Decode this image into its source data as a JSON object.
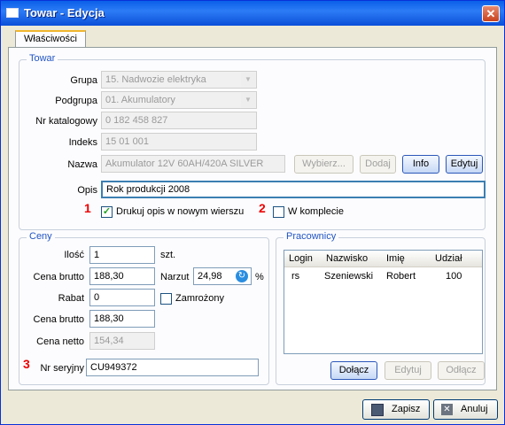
{
  "window": {
    "title": "Towar - Edycja",
    "close_glyph": "✕"
  },
  "tabs": [
    "Właściwości"
  ],
  "towar": {
    "legend": "Towar",
    "grupa_label": "Grupa",
    "grupa_value": "15. Nadwozie elektryka",
    "podgrupa_label": "Podgrupa",
    "podgrupa_value": "01. Akumulatory",
    "nrkat_label": "Nr katalogowy",
    "nrkat_value": "0 182 458 827",
    "indeks_label": "Indeks",
    "indeks_value": "15 01 001",
    "nazwa_label": "Nazwa",
    "nazwa_value": "Akumulator 12V 60AH/420A SILVER",
    "wybierz_btn": "Wybierz...",
    "dodaj_btn": "Dodaj",
    "info_btn": "Info",
    "edytuj_btn": "Edytuj",
    "opis_label": "Opis",
    "opis_value": "Rok produkcji 2008",
    "drukuj_label": "Drukuj opis w nowym wierszu",
    "drukuj_checked": true,
    "komplet_label": "W komplecie",
    "komplet_checked": false
  },
  "markers": {
    "one": "1",
    "two": "2",
    "three": "3"
  },
  "ceny": {
    "legend": "Ceny",
    "ilosc_label": "Ilość",
    "ilosc_value": "1",
    "ilosc_unit": "szt.",
    "cena_brutto_label": "Cena brutto",
    "cena_brutto_value": "188,30",
    "narzut_label": "Narzut",
    "narzut_value": "24,98",
    "narzut_unit": "%",
    "rabat_label": "Rabat",
    "rabat_value": "0",
    "zamrozony_label": "Zamrożony",
    "zamrozony_checked": false,
    "cena_brutto2_label": "Cena brutto",
    "cena_brutto2_value": "188,30",
    "cena_netto_label": "Cena netto",
    "cena_netto_value": "154,34",
    "nr_seryjny_label": "Nr seryjny",
    "nr_seryjny_value": "CU949372"
  },
  "pracownicy": {
    "legend": "Pracownicy",
    "columns": [
      "Login",
      "Nazwisko",
      "Imię",
      "Udział"
    ],
    "rows": [
      [
        "rs",
        "Szeniewski",
        "Robert",
        "100"
      ]
    ],
    "dolacz_btn": "Dołącz",
    "edytuj_btn": "Edytuj",
    "odlacz_btn": "Odłącz"
  },
  "footer": {
    "zapisz_btn": "Zapisz",
    "anuluj_btn": "Anuluj"
  }
}
